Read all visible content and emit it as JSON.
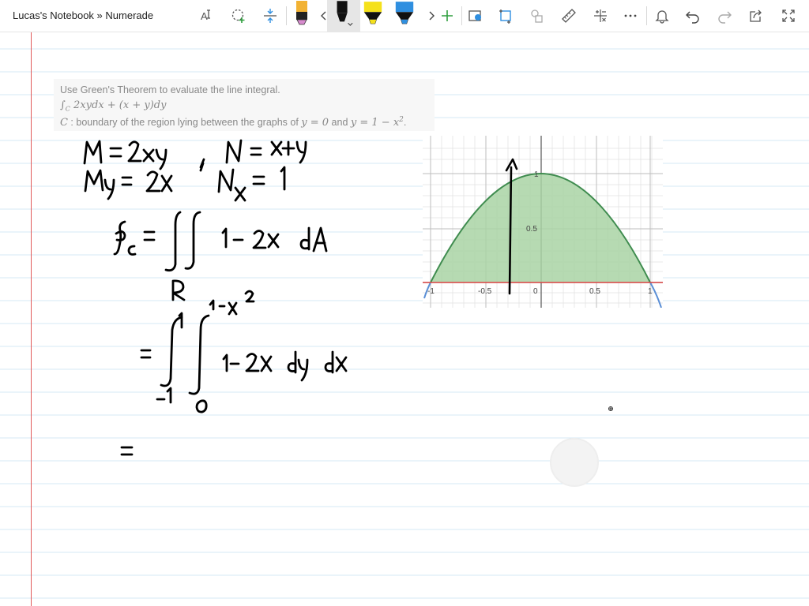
{
  "window": {
    "title": "Lucas's Notebook » Numerade"
  },
  "toolbar": {
    "icons": [
      "text-format-icon",
      "lasso-select-icon",
      "insert-space-icon",
      "pen-pink-icon",
      "chevron-left-icon",
      "pen-black-icon",
      "highlighter-yellow-icon",
      "highlighter-blue-icon",
      "chevron-right-icon",
      "add-icon",
      "screenshot-icon",
      "crop-icon",
      "shapes-icon",
      "ruler-icon",
      "math-icon",
      "more-icon",
      "bell-icon",
      "undo-icon",
      "redo-icon",
      "share-icon",
      "fullscreen-icon"
    ],
    "colors": {
      "pen_pink": "#d88ccf",
      "pen_black": "#111111",
      "highlighter_yellow": "#f5e11b",
      "highlighter_blue": "#2f8fe0",
      "accent_green": "#2e9e3e"
    }
  },
  "problem": {
    "line1": "Use Green's Theorem to evaluate the line integral.",
    "integral_sym": "∫",
    "integral_sub": "C",
    "integrand": "2xydx + (x + y)dy",
    "c_label": "C",
    "line3_text": " : boundary of the region lying between the graphs of ",
    "eq1": "y = 0",
    "and_text": " and ",
    "eq2": "y = 1 − x",
    "eq2_exp": "2",
    "period": "."
  },
  "graph": {
    "x_ticks": [
      "-1",
      "-0.5",
      "0",
      "0.5",
      "1"
    ],
    "y_ticks": [
      "1",
      "0.5"
    ],
    "colors": {
      "fill": "#a9d3a4",
      "curve": "#3f8c4f",
      "baseline": "#e04a4a",
      "tail": "#5b8fd6",
      "grid": "#d9d9d9",
      "axis": "#555555"
    }
  },
  "handwriting": {
    "lines": [
      "M = 2xy  ,  N = x + y",
      "My = 2x  ,  Nx = 1",
      "∮c = ∬R 1 - 2x dA",
      "= ∫-1^1 ∫0^(1-x^2) 1 - 2x dy dx",
      "="
    ]
  }
}
